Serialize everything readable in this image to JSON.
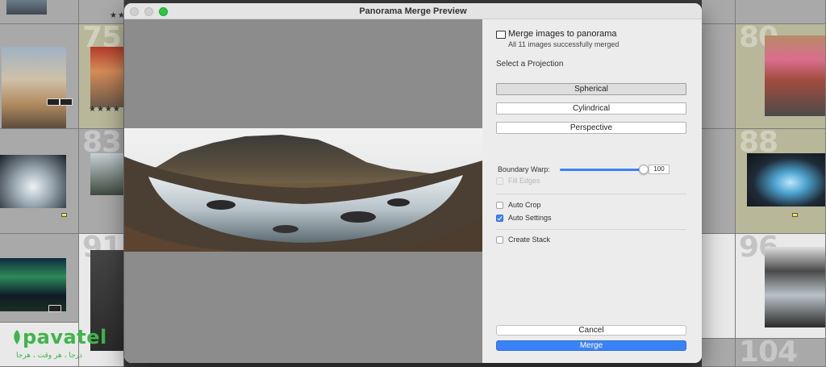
{
  "dialog": {
    "title": "Panorama Merge Preview",
    "message_title": "Merge images to panorama",
    "message_sub": "All 11 images successfully merged",
    "projection_label": "Select a Projection",
    "projections": [
      "Spherical",
      "Cylindrical",
      "Perspective"
    ],
    "selected_projection": "Spherical",
    "boundary_warp_label": "Boundary Warp:",
    "boundary_warp_value": "100",
    "boundary_warp_level": 1.0,
    "fill_edges_label": "Fill Edges",
    "auto_crop_label": "Auto Crop",
    "auto_settings_label": "Auto Settings",
    "create_stack_label": "Create Stack",
    "checkboxes": {
      "fill_edges": false,
      "auto_crop": false,
      "auto_settings": true,
      "create_stack": false
    },
    "cancel_label": "Cancel",
    "merge_label": "Merge"
  },
  "grid": {
    "cell_numbers": [
      "75",
      "80",
      "83",
      "88",
      "91",
      "96",
      "104"
    ],
    "stars": "★★★★"
  },
  "watermark": {
    "brand": "pavatel",
    "tagline": "درجا ، هر وقت ، هرجا"
  },
  "colors": {
    "accent": "#3a82f7",
    "traffic_light_zoom": "#28c840",
    "watermark_green": "#3fb54b"
  }
}
